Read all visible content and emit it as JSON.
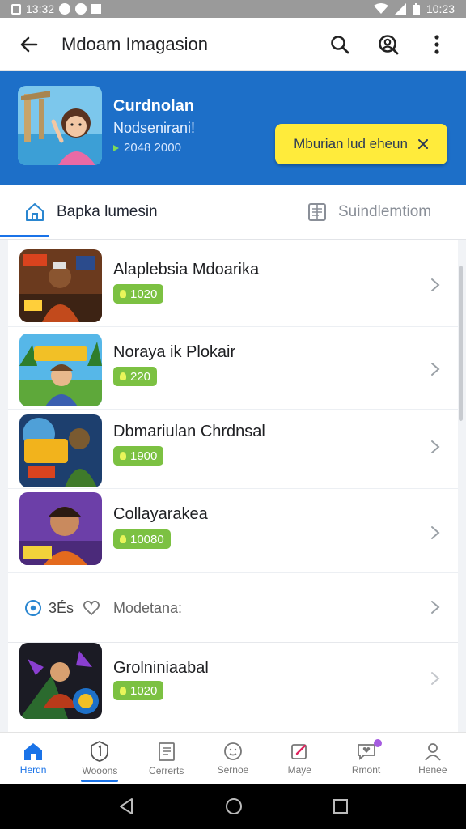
{
  "status_bar": {
    "time_left": "13:32",
    "time_right": "10:23"
  },
  "app_bar": {
    "title": "Mdoam Imagasion"
  },
  "banner": {
    "name": "Curdnolan",
    "subtitle": "Nodsenirani!",
    "points": "2048 2000",
    "cta_label": "Mburian lud eheun",
    "background_color": "#1d6fc8",
    "cta_color": "#ffeb3b"
  },
  "tabs": [
    {
      "label": "Bapka lumesin",
      "icon": "home-outline-icon",
      "active": true
    },
    {
      "label": "Suindlemtiom",
      "icon": "list-doc-icon",
      "active": false
    }
  ],
  "games": [
    {
      "name": "Alaplebsia Mdoarika",
      "points": "1020",
      "art": "warrior-game-art"
    },
    {
      "name": "Noraya ik Plokair",
      "points": "220",
      "art": "adventure-game-art"
    },
    {
      "name": "Dbmariulan Chrdnsal",
      "points": "1900",
      "art": "battle-game-art"
    },
    {
      "name": "Collayarakea",
      "points": "10080",
      "art": "hero-game-art"
    },
    {
      "name": "Grolniniaabal",
      "points": "1020",
      "art": "fighter-game-art"
    }
  ],
  "section_row": {
    "prefix": "3És",
    "label": "Modetana:"
  },
  "bottom_nav": [
    {
      "label": "Herdn",
      "icon": "home-icon",
      "active": true
    },
    {
      "label": "Wooons",
      "icon": "badge-icon",
      "active": false,
      "selected": true
    },
    {
      "label": "Cerrerts",
      "icon": "document-icon",
      "active": false
    },
    {
      "label": "Sernoe",
      "icon": "smiley-icon",
      "active": false
    },
    {
      "label": "Maye",
      "icon": "edit-icon",
      "active": false
    },
    {
      "label": "Rmont",
      "icon": "heart-chat-icon",
      "active": false,
      "notification": true
    },
    {
      "label": "Henee",
      "icon": "profile-icon",
      "active": false
    }
  ],
  "accent_color": "#1a73e8",
  "badge_color": "#7cc142"
}
